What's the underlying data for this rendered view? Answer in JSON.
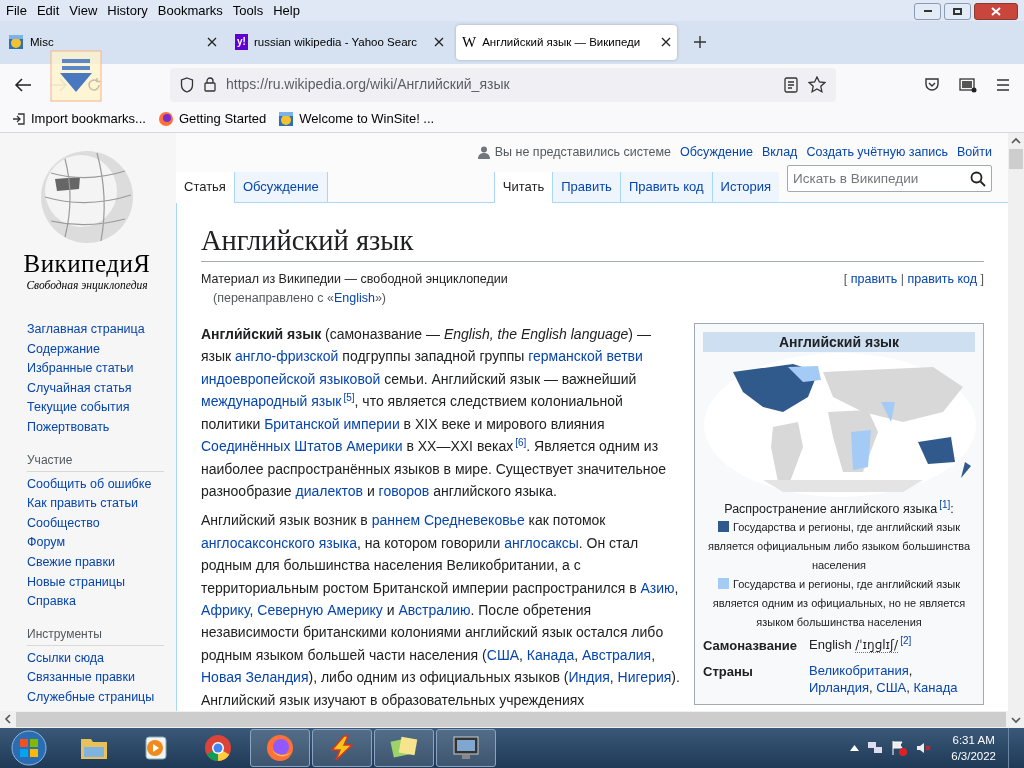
{
  "menu": [
    "File",
    "Edit",
    "View",
    "History",
    "Bookmarks",
    "Tools",
    "Help"
  ],
  "tabs": [
    {
      "title": "Misc",
      "kind": "globe",
      "selected": false
    },
    {
      "title": "russian wikipedia - Yahoo Searc",
      "kind": "text",
      "icon_text": "y!",
      "selected": false
    },
    {
      "title": "Английский язык — Википеди",
      "kind": "text",
      "icon_text": "W",
      "selected": true
    }
  ],
  "address": {
    "url": "https://ru.wikipedia.org/wiki/Английский_язык"
  },
  "bookmarks": [
    {
      "title": "Import bookmarks...",
      "kind": "import"
    },
    {
      "title": "Getting Started",
      "kind": "fox"
    },
    {
      "title": "Welcome to WinSite! ...",
      "kind": "globe"
    }
  ],
  "wiki": {
    "personal": {
      "status": "Вы не представились системе",
      "links": [
        "Обсуждение",
        "Вклад",
        "Создать учётную запись",
        "Войти"
      ]
    },
    "logo": {
      "title": "ВикипедиЯ",
      "tagline": "Свободная энциклопедия"
    },
    "sidebar": [
      {
        "items": [
          "Заглавная страница",
          "Содержание",
          "Избранные статьи",
          "Случайная статья",
          "Текущие события",
          "Пожертвовать"
        ]
      },
      {
        "heading": "Участие",
        "items": [
          "Сообщить об ошибке",
          "Как править статьи",
          "Сообщество",
          "Форум",
          "Свежие правки",
          "Новые страницы",
          "Справка"
        ]
      },
      {
        "heading": "Инструменты",
        "items": [
          "Ссылки сюда",
          "Связанные правки",
          "Служебные страницы"
        ]
      }
    ],
    "left_tabs": [
      {
        "label": "Статья",
        "selected": true
      },
      {
        "label": "Обсуждение",
        "selected": false
      }
    ],
    "right_tabs": [
      {
        "label": "Читать",
        "selected": true
      },
      {
        "label": "Править",
        "selected": false
      },
      {
        "label": "Править код",
        "selected": false
      },
      {
        "label": "История",
        "selected": false
      }
    ],
    "search": {
      "placeholder": "Искать в Википедии"
    },
    "heading": "Английский язык",
    "subtitle": "Материал из Википедии — свободной энциклопедии",
    "redirect": [
      {
        "kind": "plain",
        "text": "(перенаправлено с «"
      },
      {
        "kind": "link",
        "text": "English"
      },
      {
        "kind": "plain",
        "text": "»)"
      }
    ],
    "edit_links": [
      {
        "kind": "plain",
        "text": "[ "
      },
      {
        "kind": "link",
        "text": "править"
      },
      {
        "kind": "plain",
        "text": " | "
      },
      {
        "kind": "link",
        "text": "править код"
      },
      {
        "kind": "plain",
        "text": " ]"
      }
    ],
    "paragraphs": [
      [
        {
          "kind": "bold",
          "text": "Англи́йский язык"
        },
        {
          "kind": "plain",
          "text": " (самоназвание — "
        },
        {
          "kind": "italic",
          "text": "English, the English language"
        },
        {
          "kind": "plain",
          "text": ") — язык "
        },
        {
          "kind": "link",
          "text": "англо-фризской"
        },
        {
          "kind": "plain",
          "text": " подгруппы западной группы "
        },
        {
          "kind": "link",
          "text": "германской ветви"
        },
        {
          "kind": "space"
        },
        {
          "kind": "link",
          "text": "индоевропейской языковой"
        },
        {
          "kind": "plain",
          "text": " семьи. Английский язык — важнейший "
        },
        {
          "kind": "link",
          "text": "международный язык"
        },
        {
          "kind": "ref",
          "text": "[5]"
        },
        {
          "kind": "plain",
          "text": ", что является следствием колониальной политики "
        },
        {
          "kind": "link",
          "text": "Британской империи"
        },
        {
          "kind": "plain",
          "text": " в XIX веке и мирового влияния "
        },
        {
          "kind": "link",
          "text": "Соединённых Штатов Америки"
        },
        {
          "kind": "plain",
          "text": " в XX—XXI веках"
        },
        {
          "kind": "ref",
          "text": "[6]"
        },
        {
          "kind": "plain",
          "text": ". Является одним из наиболее распространённых языков в мире. Существует значительное разнообразие "
        },
        {
          "kind": "link",
          "text": "диалектов"
        },
        {
          "kind": "plain",
          "text": " и "
        },
        {
          "kind": "link",
          "text": "говоров"
        },
        {
          "kind": "plain",
          "text": " английского языка."
        }
      ],
      [
        {
          "kind": "plain",
          "text": "Английский язык возник в "
        },
        {
          "kind": "link",
          "text": "раннем Средневековье"
        },
        {
          "kind": "plain",
          "text": " как потомок "
        },
        {
          "kind": "link",
          "text": "англосаксонского языка"
        },
        {
          "kind": "plain",
          "text": ", на котором говорили "
        },
        {
          "kind": "link",
          "text": "англосаксы"
        },
        {
          "kind": "plain",
          "text": ". Он стал родным для большинства населения Великобритании, а с территориальным ростом Британской империи распространился в "
        },
        {
          "kind": "link",
          "text": "Азию"
        },
        {
          "kind": "plain",
          "text": ", "
        },
        {
          "kind": "link",
          "text": "Африку"
        },
        {
          "kind": "plain",
          "text": ", "
        },
        {
          "kind": "link",
          "text": "Северную Америку"
        },
        {
          "kind": "plain",
          "text": " и "
        },
        {
          "kind": "link",
          "text": "Австралию"
        },
        {
          "kind": "plain",
          "text": ". После обретения независимости британскими колониями английский язык остался либо родным языком большей части населения ("
        },
        {
          "kind": "link",
          "text": "США"
        },
        {
          "kind": "plain",
          "text": ", "
        },
        {
          "kind": "link",
          "text": "Канада"
        },
        {
          "kind": "plain",
          "text": ", "
        },
        {
          "kind": "link",
          "text": "Австралия"
        },
        {
          "kind": "plain",
          "text": ", "
        },
        {
          "kind": "link",
          "text": "Новая Зеландия"
        },
        {
          "kind": "plain",
          "text": "), либо одним из официальных языков ("
        },
        {
          "kind": "link",
          "text": "Индия"
        },
        {
          "kind": "plain",
          "text": ", "
        },
        {
          "kind": "link",
          "text": "Нигерия"
        },
        {
          "kind": "plain",
          "text": "). Английский язык изучают в образовательных учреждениях"
        }
      ]
    ],
    "infobox": {
      "title": "Английский язык",
      "caption": [
        {
          "kind": "plain",
          "text": "Распространение английского языка"
        },
        {
          "kind": "ref",
          "text": "[1]"
        },
        {
          "kind": "plain",
          "text": ":"
        }
      ],
      "legend": [
        {
          "color": "#30598c",
          "text": "Государства и регионы, где английский язык является официальным либо языком большинства населения"
        },
        {
          "color": "#a3cbf5",
          "text": "Государства и регионы, где английский язык является одним из официальных, но не является языком большинства населения"
        }
      ],
      "rows": [
        {
          "label": "Самоназвание",
          "value": [
            {
              "kind": "plain",
              "text": "English "
            },
            {
              "kind": "abbr",
              "text": "/ˈɪŋɡlɪʃ/"
            },
            {
              "kind": "ref",
              "text": "[2]"
            }
          ]
        },
        {
          "label": "Страны",
          "value": [
            {
              "kind": "link",
              "text": "Великобритания"
            },
            {
              "kind": "plain",
              "text": ", "
            },
            {
              "kind": "link",
              "text": "Ирландия"
            },
            {
              "kind": "plain",
              "text": ", "
            },
            {
              "kind": "link",
              "text": "США"
            },
            {
              "kind": "plain",
              "text": ", "
            },
            {
              "kind": "link",
              "text": "Канада"
            }
          ]
        }
      ]
    }
  },
  "taskbar": {
    "apps": [
      {
        "kind": "folder",
        "running": false
      },
      {
        "kind": "media",
        "running": false
      },
      {
        "kind": "chrome",
        "running": false
      },
      {
        "kind": "firefox",
        "running": true
      },
      {
        "kind": "bolt",
        "running": true
      },
      {
        "kind": "notes",
        "running": true
      },
      {
        "kind": "monitor",
        "running": true
      }
    ],
    "time": "6:31 AM",
    "date": "6/3/2022"
  }
}
